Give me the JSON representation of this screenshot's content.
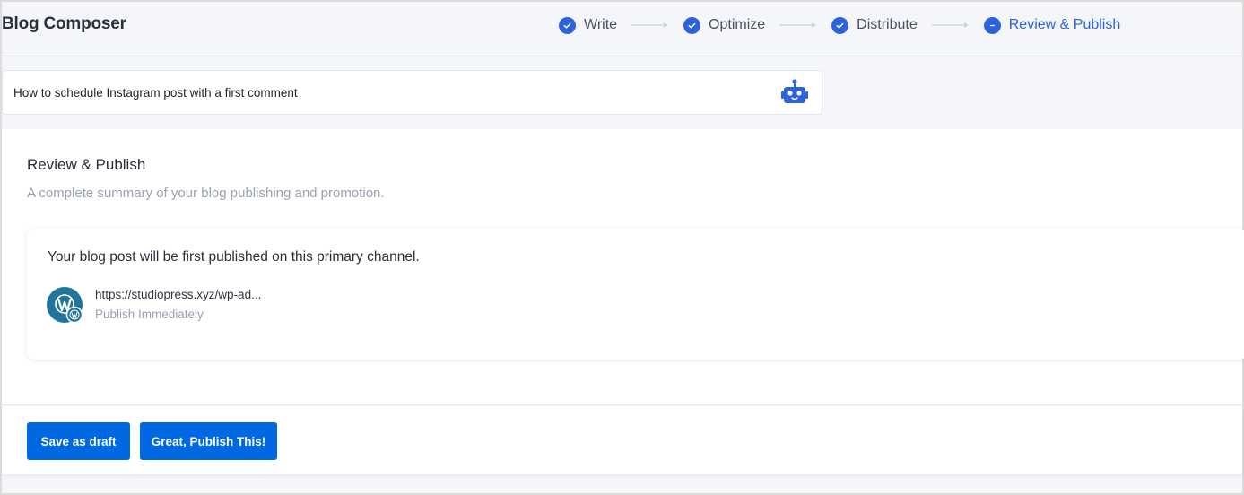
{
  "header": {
    "title": "Blog Composer",
    "steps": [
      {
        "label": "Write",
        "status": "complete",
        "icon": "check-icon"
      },
      {
        "label": "Optimize",
        "status": "complete",
        "icon": "check-icon"
      },
      {
        "label": "Distribute",
        "status": "complete",
        "icon": "check-icon"
      },
      {
        "label": "Review & Publish",
        "status": "current",
        "icon": "minus-icon"
      }
    ]
  },
  "post": {
    "title": "How to schedule Instagram post with a first comment",
    "assistant_icon": "robot-icon"
  },
  "review": {
    "title": "Review & Publish",
    "subtitle": "A complete summary of your blog publishing and promotion.",
    "primary_channel": {
      "heading": "Your blog post will be first published on this primary channel.",
      "platform_icon": "wordpress-icon",
      "url": "https://studiopress.xyz/wp-ad...",
      "schedule": "Publish Immediately"
    }
  },
  "actions": {
    "save_draft_label": "Save as draft",
    "publish_label": "Great, Publish This!"
  },
  "colors": {
    "accent": "#2d63d8",
    "button": "#0068e0",
    "wordpress": "#21759b",
    "muted_text": "#9aa1b1"
  }
}
